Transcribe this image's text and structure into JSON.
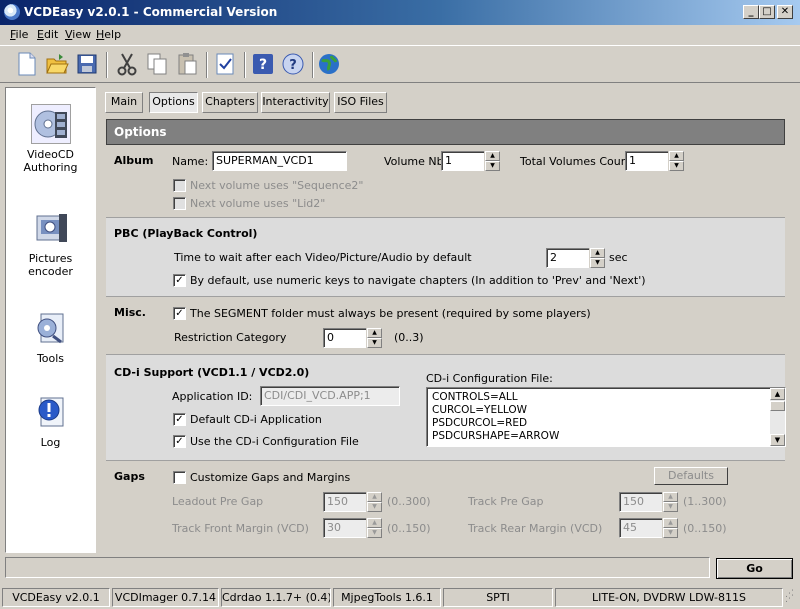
{
  "window": {
    "title": "VCDEasy v2.0.1 - Commercial Version"
  },
  "menu": [
    {
      "label": "File",
      "key": "F"
    },
    {
      "label": "Edit",
      "key": "E"
    },
    {
      "label": "View",
      "key": "V"
    },
    {
      "label": "Help",
      "key": "H"
    }
  ],
  "toolbar_icons": [
    "new-icon",
    "open-icon",
    "save-icon",
    "cut-icon",
    "copy-icon",
    "paste-icon",
    "check-icon",
    "help-icon",
    "about-icon",
    "web-icon"
  ],
  "sidebar": {
    "items": [
      {
        "label1": "VideoCD",
        "label2": "Authoring",
        "icon": "videocd-icon"
      },
      {
        "label1": "Pictures",
        "label2": "encoder",
        "icon": "pictures-icon"
      },
      {
        "label1": "Tools",
        "label2": "",
        "icon": "tools-icon"
      },
      {
        "label1": "Log",
        "label2": "",
        "icon": "log-icon"
      }
    ]
  },
  "tabs": [
    "Main",
    "Options",
    "Chapters",
    "Interactivity",
    "ISO Files"
  ],
  "active_tab": "Options",
  "options": {
    "header": "Options",
    "album": {
      "title": "Album",
      "name_label": "Name:",
      "name_value": "SUPERMAN_VCD1",
      "volume_nb_label": "Volume Nb:",
      "volume_nb_value": "1",
      "total_label": "Total Volumes Count:",
      "total_value": "1",
      "next_seq2": "Next volume uses \"Sequence2\"",
      "next_lid2": "Next volume uses \"Lid2\""
    },
    "pbc": {
      "title": "PBC (PlayBack Control)",
      "wait_label": "Time to wait after each Video/Picture/Audio by default",
      "wait_value": "2",
      "wait_unit": "sec",
      "numeric_keys": "By default, use numeric keys to navigate chapters (In addition to 'Prev' and 'Next')"
    },
    "misc": {
      "title": "Misc.",
      "segment_label": "The SEGMENT folder must always be present (required by some players)",
      "restriction_label": "Restriction Category",
      "restriction_value": "0",
      "restriction_range": "(0..3)"
    },
    "cdi": {
      "title": "CD-i Support (VCD1.1 / VCD2.0)",
      "appid_label": "Application ID:",
      "appid_value": "CDI/CDI_VCD.APP;1",
      "default_cdi": "Default CD-i Application",
      "use_cfg": "Use the CD-i Configuration File",
      "cfg_label": "CD-i Configuration File:",
      "cfg_lines": [
        "CONTROLS=ALL",
        "CURCOL=YELLOW",
        "PSDCURCOL=RED",
        "PSDCURSHAPE=ARROW"
      ]
    },
    "gaps": {
      "title": "Gaps",
      "customize": "Customize Gaps and Margins",
      "defaults_button": "Defaults",
      "leadout_label": "Leadout Pre Gap",
      "leadout_value": "150",
      "leadout_range": "(0..300)",
      "track_pre_label": "Track Pre Gap",
      "track_pre_value": "150",
      "track_pre_range": "(1..300)",
      "front_label": "Track Front Margin (VCD)",
      "front_value": "30",
      "front_range": "(0..150)",
      "rear_label": "Track Rear Margin (VCD)",
      "rear_value": "45",
      "rear_range": "(0..150)"
    }
  },
  "go_button": "Go",
  "status": [
    "VCDEasy v2.0.1",
    "VCDImager 0.7.14",
    "Cdrdao 1.1.7+ (0.4)",
    "MjpegTools 1.6.1",
    "SPTI",
    "LITE-ON, DVDRW LDW-811S"
  ]
}
